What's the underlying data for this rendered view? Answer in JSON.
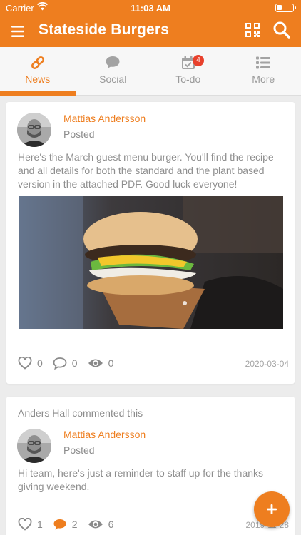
{
  "status_bar": {
    "carrier": "Carrier",
    "time": "11:03 AM"
  },
  "app_bar": {
    "title": "Stateside Burgers"
  },
  "tabs": [
    {
      "label": "News",
      "icon": "link-icon",
      "active": true
    },
    {
      "label": "Social",
      "icon": "chat-bubble-icon",
      "active": false
    },
    {
      "label": "To-do",
      "icon": "calendar-check-icon",
      "badge": "4",
      "active": false
    },
    {
      "label": "More",
      "icon": "list-icon",
      "active": false
    }
  ],
  "posts": [
    {
      "author": "Mattias Andersson",
      "action": "Posted",
      "text": "Here's the March guest menu burger. You'll find the recipe and all details for both the standard and the plant based version in the attached PDF. Good luck everyone!",
      "likes": "0",
      "comments": "0",
      "views": "0",
      "date": "2020-03-04"
    },
    {
      "commented_by": "Anders Hall commented this",
      "author": "Mattias Andersson",
      "action": "Posted",
      "text": "Hi team, here's just a reminder to staff up for the thanks giving weekend.",
      "likes": "1",
      "comments": "2",
      "views": "6",
      "date": "2019-11-28"
    }
  ],
  "colors": {
    "accent": "#ee7e1f",
    "badge": "#e8412c"
  }
}
